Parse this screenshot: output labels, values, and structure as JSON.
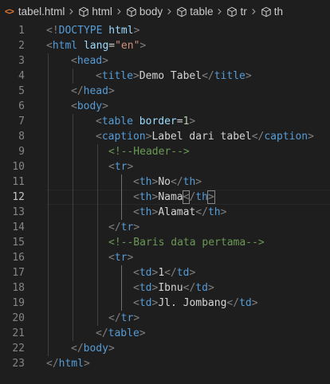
{
  "breadcrumb": {
    "file": "tabel.html",
    "items": [
      "html",
      "body",
      "table",
      "tr",
      "th"
    ]
  },
  "editor": {
    "current_line": 12,
    "lines": [
      {
        "n": "1",
        "tokens": [
          [
            "bracket",
            "<!"
          ],
          [
            "tag",
            "DOCTYPE"
          ],
          [
            "text",
            " "
          ],
          [
            "attr",
            "html"
          ],
          [
            "bracket",
            ">"
          ]
        ]
      },
      {
        "n": "2",
        "tokens": [
          [
            "bracket",
            "<"
          ],
          [
            "tag",
            "html"
          ],
          [
            "text",
            " "
          ],
          [
            "attr",
            "lang"
          ],
          [
            "text",
            "="
          ],
          [
            "str",
            "\"en\""
          ],
          [
            "bracket",
            ">"
          ]
        ]
      },
      {
        "n": "3",
        "tokens": [
          [
            "bracket",
            "<"
          ],
          [
            "tag",
            "head"
          ],
          [
            "bracket",
            ">"
          ]
        ]
      },
      {
        "n": "4",
        "tokens": [
          [
            "bracket",
            "<"
          ],
          [
            "tag",
            "title"
          ],
          [
            "bracket",
            ">"
          ],
          [
            "text",
            "Demo Tabel"
          ],
          [
            "bracket",
            "</"
          ],
          [
            "tag",
            "title"
          ],
          [
            "bracket",
            ">"
          ]
        ]
      },
      {
        "n": "5",
        "tokens": [
          [
            "bracket",
            "</"
          ],
          [
            "tag",
            "head"
          ],
          [
            "bracket",
            ">"
          ]
        ]
      },
      {
        "n": "6",
        "tokens": [
          [
            "bracket",
            "<"
          ],
          [
            "tag",
            "body"
          ],
          [
            "bracket",
            ">"
          ]
        ]
      },
      {
        "n": "7",
        "tokens": [
          [
            "bracket",
            "<"
          ],
          [
            "tag",
            "table"
          ],
          [
            "text",
            " "
          ],
          [
            "attr",
            "border"
          ],
          [
            "text",
            "="
          ],
          [
            "num",
            "1"
          ],
          [
            "bracket",
            ">"
          ]
        ]
      },
      {
        "n": "8",
        "tokens": [
          [
            "bracket",
            "<"
          ],
          [
            "tag",
            "caption"
          ],
          [
            "bracket",
            ">"
          ],
          [
            "text",
            "Label dari tabel"
          ],
          [
            "bracket",
            "</"
          ],
          [
            "tag",
            "caption"
          ],
          [
            "bracket",
            ">"
          ]
        ]
      },
      {
        "n": "9",
        "tokens": [
          [
            "comment",
            "<!--Header-->"
          ]
        ]
      },
      {
        "n": "10",
        "tokens": [
          [
            "bracket",
            "<"
          ],
          [
            "tag",
            "tr"
          ],
          [
            "bracket",
            ">"
          ]
        ]
      },
      {
        "n": "11",
        "tokens": [
          [
            "bracket",
            "<"
          ],
          [
            "tag",
            "th"
          ],
          [
            "bracket",
            ">"
          ],
          [
            "text",
            "No"
          ],
          [
            "bracket",
            "</"
          ],
          [
            "tag",
            "th"
          ],
          [
            "bracket",
            ">"
          ]
        ]
      },
      {
        "n": "12",
        "tokens": [
          [
            "bracket",
            "<"
          ],
          [
            "tag",
            "th"
          ],
          [
            "bracket",
            ">"
          ],
          [
            "text",
            "Nama"
          ],
          [
            "bracketc",
            "<"
          ],
          [
            "bracket",
            "/"
          ],
          [
            "tag",
            "th"
          ],
          [
            "bracketc",
            ">"
          ]
        ]
      },
      {
        "n": "13",
        "tokens": [
          [
            "bracket",
            "<"
          ],
          [
            "tag",
            "th"
          ],
          [
            "bracket",
            ">"
          ],
          [
            "text",
            "Alamat"
          ],
          [
            "bracket",
            "</"
          ],
          [
            "tag",
            "th"
          ],
          [
            "bracket",
            ">"
          ]
        ]
      },
      {
        "n": "14",
        "tokens": [
          [
            "bracket",
            "</"
          ],
          [
            "tag",
            "tr"
          ],
          [
            "bracket",
            ">"
          ]
        ]
      },
      {
        "n": "15",
        "tokens": [
          [
            "comment",
            "<!--Baris data pertama-->"
          ]
        ]
      },
      {
        "n": "16",
        "tokens": [
          [
            "bracket",
            "<"
          ],
          [
            "tag",
            "tr"
          ],
          [
            "bracket",
            ">"
          ]
        ]
      },
      {
        "n": "17",
        "tokens": [
          [
            "bracket",
            "<"
          ],
          [
            "tag",
            "td"
          ],
          [
            "bracket",
            ">"
          ],
          [
            "text",
            "1"
          ],
          [
            "bracket",
            "</"
          ],
          [
            "tag",
            "td"
          ],
          [
            "bracket",
            ">"
          ]
        ]
      },
      {
        "n": "18",
        "tokens": [
          [
            "bracket",
            "<"
          ],
          [
            "tag",
            "td"
          ],
          [
            "bracket",
            ">"
          ],
          [
            "text",
            "Ibnu"
          ],
          [
            "bracket",
            "</"
          ],
          [
            "tag",
            "td"
          ],
          [
            "bracket",
            ">"
          ]
        ]
      },
      {
        "n": "19",
        "tokens": [
          [
            "bracket",
            "<"
          ],
          [
            "tag",
            "td"
          ],
          [
            "bracket",
            ">"
          ],
          [
            "text",
            "Jl. Jombang"
          ],
          [
            "bracket",
            "</"
          ],
          [
            "tag",
            "td"
          ],
          [
            "bracket",
            ">"
          ]
        ]
      },
      {
        "n": "20",
        "tokens": [
          [
            "bracket",
            "</"
          ],
          [
            "tag",
            "tr"
          ],
          [
            "bracket",
            ">"
          ]
        ]
      },
      {
        "n": "21",
        "tokens": [
          [
            "bracket",
            "</"
          ],
          [
            "tag",
            "table"
          ],
          [
            "bracket",
            ">"
          ]
        ]
      },
      {
        "n": "22",
        "tokens": [
          [
            "bracket",
            "</"
          ],
          [
            "tag",
            "body"
          ],
          [
            "bracket",
            ">"
          ]
        ]
      },
      {
        "n": "23",
        "tokens": [
          [
            "bracket",
            "</"
          ],
          [
            "tag",
            "html"
          ],
          [
            "bracket",
            ">"
          ]
        ]
      }
    ]
  }
}
